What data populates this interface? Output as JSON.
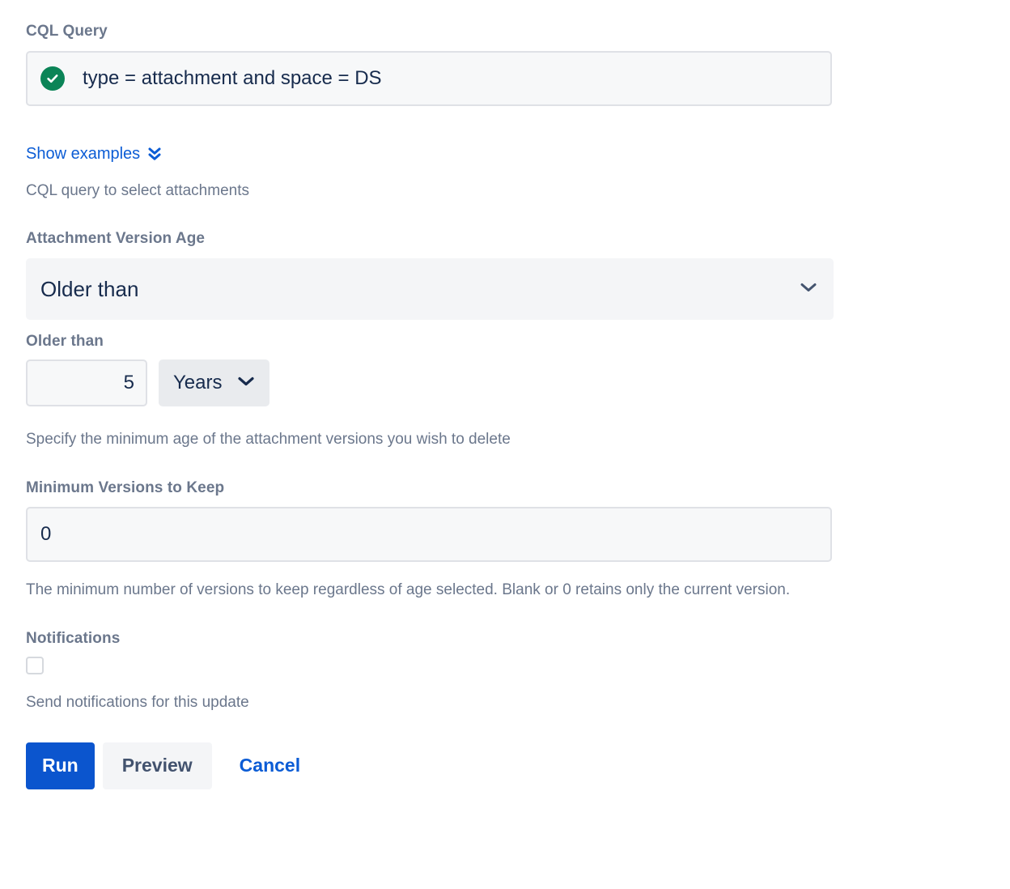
{
  "cql": {
    "label": "CQL Query",
    "value": "type = attachment and space = DS",
    "valid_icon": "check-circle-icon",
    "valid_color": "#0B8457",
    "examples_link": "Show examples",
    "examples_icon": "double-chevron-down-icon",
    "help": "CQL query to select attachments"
  },
  "version_age": {
    "label": "Attachment Version Age",
    "selected": "Older than",
    "chevron_icon": "chevron-down-icon"
  },
  "older_than": {
    "label": "Older than",
    "amount": "5",
    "unit": "Years",
    "unit_chevron_icon": "chevron-down-icon",
    "help": "Specify the minimum age of the attachment versions you wish to delete"
  },
  "min_versions": {
    "label": "Minimum Versions to Keep",
    "value": "0",
    "help": "The minimum number of versions to keep regardless of age selected. Blank or 0 retains only the current version."
  },
  "notifications": {
    "label": "Notifications",
    "checked": false,
    "checkbox_label": "Send notifications for this update"
  },
  "actions": {
    "run": "Run",
    "preview": "Preview",
    "cancel": "Cancel",
    "primary_color": "#0B55CE",
    "link_color": "#0B5CD5"
  }
}
